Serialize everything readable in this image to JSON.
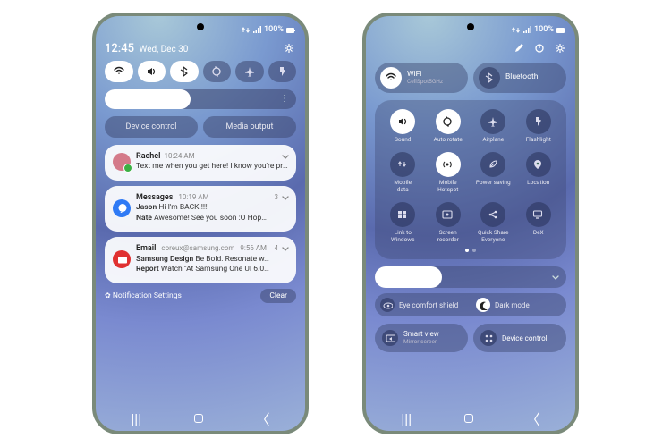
{
  "status": {
    "battery_pct": "100%"
  },
  "left": {
    "time": "12:45",
    "date": "Wed, Dec 30",
    "qs": [
      "wifi",
      "sound",
      "bluetooth",
      "rotate",
      "airplane",
      "flashlight"
    ],
    "brightness_pct": 45,
    "device_control": "Device control",
    "media_output": "Media output",
    "notifications": [
      {
        "app": "messages",
        "avatar_color": "#d47a8a",
        "badge_color": "#3cb043",
        "title": "Rachel",
        "time": "10:24 AM",
        "lines": [
          "Text me when you get here! I know you're probably having cravings. W…"
        ]
      },
      {
        "app": "messages",
        "avatar_color": "#2f7af5",
        "title": "Messages",
        "time": "10:19 AM",
        "count": 3,
        "lines": [
          {
            "name": "Jason",
            "text": "Hi I'm BACK!!!!!"
          },
          {
            "name": "Nate",
            "text": "Awesome! See you soon :O Hop…"
          }
        ]
      },
      {
        "app": "email",
        "avatar_color": "#e03131",
        "title": "Email",
        "subtitle": "coreux@samsung.com",
        "time": "9:56 AM",
        "count": 4,
        "lines": [
          {
            "name": "Samsung Design",
            "text": "Be Bold. Resonate w…"
          },
          {
            "name": "Report",
            "text": "Watch \"At Samsung One UI 6.0…"
          }
        ]
      }
    ],
    "settings_link": "Notification Settings",
    "clear": "Clear"
  },
  "right": {
    "big_tiles": [
      {
        "id": "wifi",
        "label": "WiFi",
        "sub": "CellSpot5GHz",
        "on": true
      },
      {
        "id": "bluetooth",
        "label": "Bluetooth",
        "on": false
      }
    ],
    "grid": [
      {
        "id": "sound",
        "label": "Sound",
        "on": true
      },
      {
        "id": "rotate",
        "label": "Auto rotate",
        "on": true
      },
      {
        "id": "airplane",
        "label": "Airplane",
        "on": false
      },
      {
        "id": "flashlight",
        "label": "Flashlight",
        "on": false
      },
      {
        "id": "mobiledata",
        "label": "Mobile\ndata",
        "on": false
      },
      {
        "id": "hotspot",
        "label": "Mobile\nHotspot",
        "on": true
      },
      {
        "id": "powersaving",
        "label": "Power saving",
        "on": false
      },
      {
        "id": "location",
        "label": "Location",
        "on": false
      },
      {
        "id": "linkwin",
        "label": "Link to\nWindows",
        "on": false
      },
      {
        "id": "screenrec",
        "label": "Screen\nrecorder",
        "on": false
      },
      {
        "id": "quickshare",
        "label": "Quick Share\nEveryone",
        "on": false
      },
      {
        "id": "dex",
        "label": "DeX",
        "on": false
      }
    ],
    "brightness_pct": 35,
    "eye_comfort": "Eye comfort shield",
    "dark_mode": "Dark mode",
    "smart_view": {
      "title": "Smart view",
      "sub": "Mirror screen"
    },
    "device_control": "Device control"
  }
}
